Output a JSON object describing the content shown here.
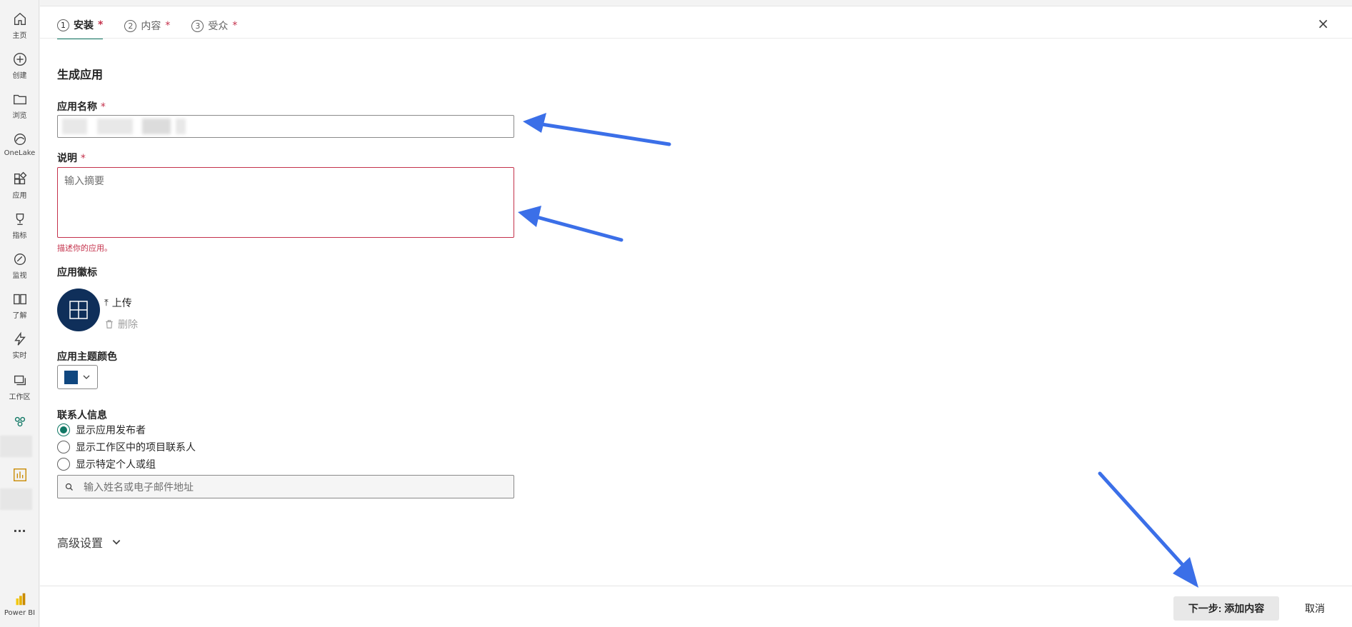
{
  "rail": {
    "items": [
      {
        "label": "主页"
      },
      {
        "label": "创建"
      },
      {
        "label": "浏览"
      },
      {
        "label": "OneLake"
      },
      {
        "label": "应用"
      },
      {
        "label": "指标"
      },
      {
        "label": "监视"
      },
      {
        "label": "了解"
      },
      {
        "label": "实时"
      },
      {
        "label": "工作区"
      }
    ],
    "more": "···",
    "powerbi_label": "Power BI"
  },
  "tabs": [
    {
      "num": "1",
      "label": "安装",
      "req": "*"
    },
    {
      "num": "2",
      "label": "内容",
      "req": "*"
    },
    {
      "num": "3",
      "label": "受众",
      "req": "*"
    }
  ],
  "close": "×",
  "form": {
    "heading": "生成应用",
    "name_label": "应用名称",
    "required_mark": "*",
    "desc_label": "说明",
    "desc_placeholder": "输入摘要",
    "desc_error": "描述你的应用。",
    "icon_label": "应用徽标",
    "upload": "上传",
    "delete": "删除",
    "theme_label": "应用主题颜色",
    "theme_color": "#10477f",
    "contact_label": "联系人信息",
    "contact_options": [
      {
        "label": "显示应用发布者",
        "checked": true
      },
      {
        "label": "显示工作区中的项目联系人",
        "checked": false
      },
      {
        "label": "显示特定个人或组",
        "checked": false
      }
    ],
    "contact_search_placeholder": "输入姓名或电子邮件地址",
    "advanced": "高级设置"
  },
  "footer": {
    "next": "下一步: 添加内容",
    "cancel": "取消"
  },
  "colors": {
    "accent": "#117865",
    "error": "#c4314b",
    "annotation_arrow": "#3b6fe8"
  }
}
